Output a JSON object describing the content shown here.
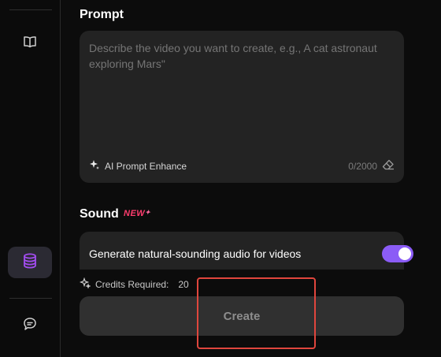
{
  "sidebar": {
    "items": [
      {
        "icon": "book-open-icon"
      },
      {
        "icon": "database-icon",
        "active": true
      },
      {
        "icon": "chat-bubble-icon"
      }
    ],
    "accent_color": "#a34df0"
  },
  "prompt": {
    "title": "Prompt",
    "placeholder": "Describe the video you want to create, e.g., A cat astronaut exploring Mars\"",
    "enhance_label": "AI Prompt Enhance",
    "counter": "0/2000"
  },
  "sound": {
    "title": "Sound",
    "badge": "NEW",
    "toggle_label": "Generate natural-sounding audio for videos",
    "toggle_on": true,
    "toggle_color": "#8b5cf6"
  },
  "credits": {
    "label": "Credits Required:",
    "value": "20"
  },
  "create_label": "Create",
  "highlight_color": "#e0463d"
}
